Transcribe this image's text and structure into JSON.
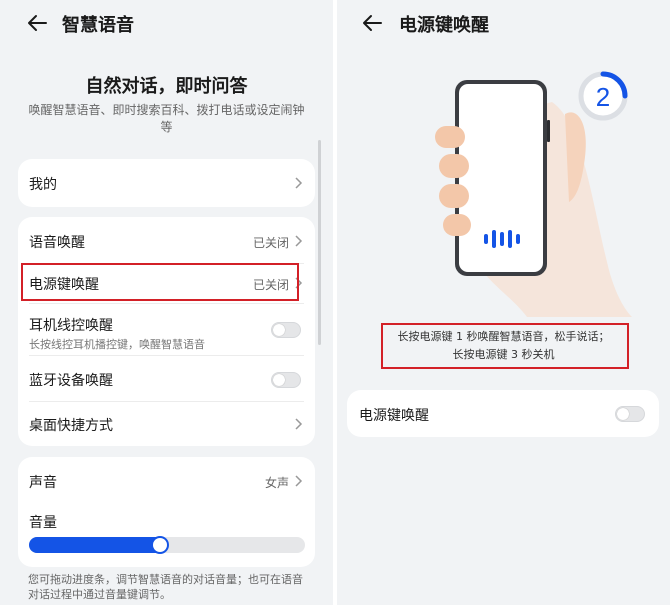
{
  "left": {
    "title": "智慧语音",
    "hero": {
      "title": "自然对话，即时问答",
      "subtitle": "唤醒智慧语音、即时搜索百科、拨打电话或设定闹钟等"
    },
    "my_label": "我的",
    "wake": {
      "voice_wake": {
        "label": "语音唤醒",
        "value": "已关闭"
      },
      "power_key_wake": {
        "label": "电源键唤醒",
        "value": "已关闭"
      },
      "earphone_wake": {
        "label": "耳机线控唤醒",
        "sub": "长按线控耳机播控键，唤醒智慧语音",
        "enabled": false
      },
      "bluetooth_wake": {
        "label": "蓝牙设备唤醒",
        "enabled": false
      },
      "desktop_shortcut": {
        "label": "桌面快捷方式"
      }
    },
    "sound": {
      "voice_label": "声音",
      "voice_value": "女声",
      "volume_label": "音量",
      "volume_level": 0.47
    },
    "footnote": "您可拖动进度条，调节智慧语音的对话音量；也可在语音对话过程中通过音量键调节。"
  },
  "right": {
    "title": "电源键唤醒",
    "illustration": {
      "step_number": "2"
    },
    "instruction": {
      "line1": "长按电源键 1 秒唤醒智慧语音，松手说话；",
      "line2": "长按电源键 3 秒关机"
    },
    "toggle_row": {
      "label": "电源键唤醒",
      "enabled": false
    }
  },
  "colors": {
    "accent": "#1454e6",
    "highlight": "#d32027",
    "background": "#f1f3f5"
  },
  "icons": [
    "back-arrow-icon",
    "chevron-right-icon",
    "phone-illustration",
    "voice-wave-icon",
    "step-counter-icon"
  ]
}
